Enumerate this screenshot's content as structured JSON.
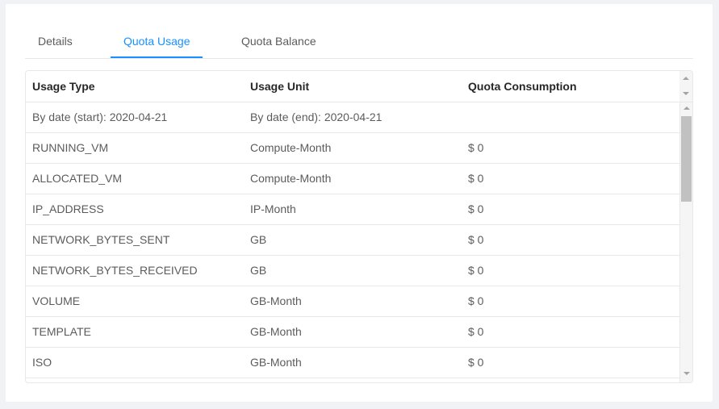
{
  "tabs": [
    {
      "label": "Details",
      "active": false
    },
    {
      "label": "Quota Usage",
      "active": true
    },
    {
      "label": "Quota Balance",
      "active": false
    }
  ],
  "table": {
    "headers": [
      "Usage Type",
      "Usage Unit",
      "Quota Consumption"
    ],
    "rows": [
      [
        "By date (start): 2020-04-21",
        "By date (end): 2020-04-21",
        ""
      ],
      [
        "RUNNING_VM",
        "Compute-Month",
        "$ 0"
      ],
      [
        "ALLOCATED_VM",
        "Compute-Month",
        "$ 0"
      ],
      [
        "IP_ADDRESS",
        "IP-Month",
        "$ 0"
      ],
      [
        "NETWORK_BYTES_SENT",
        "GB",
        "$ 0"
      ],
      [
        "NETWORK_BYTES_RECEIVED",
        "GB",
        "$ 0"
      ],
      [
        "VOLUME",
        "GB-Month",
        "$ 0"
      ],
      [
        "TEMPLATE",
        "GB-Month",
        "$ 0"
      ],
      [
        "ISO",
        "GB-Month",
        "$ 0"
      ],
      [
        "",
        "",
        ""
      ]
    ]
  },
  "colors": {
    "accent": "#1890ff",
    "border": "#e8e8e8",
    "scrollbar_thumb": "#c1c1c1"
  }
}
